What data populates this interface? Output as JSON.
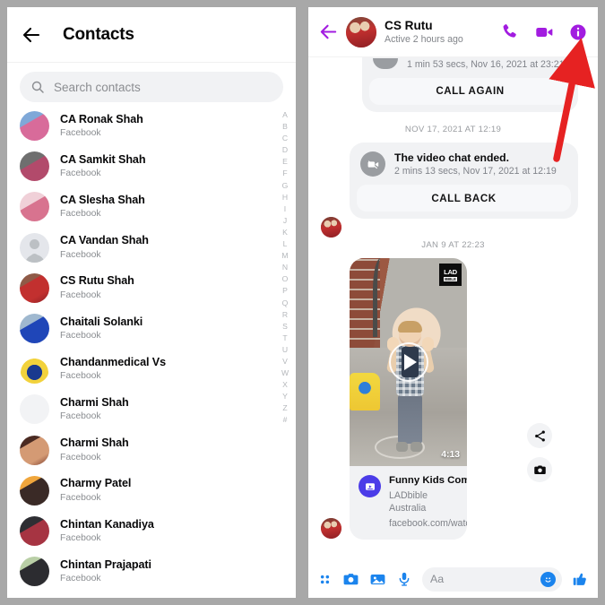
{
  "left_panel": {
    "header": {
      "title": "Contacts",
      "back_icon": "arrow-left-icon"
    },
    "search": {
      "placeholder": "Search contacts",
      "value": "",
      "icon": "search-icon"
    },
    "source_label": "Facebook",
    "contacts": [
      {
        "name": "CA Ronak Shah",
        "source": "Facebook",
        "avatar": "photo"
      },
      {
        "name": "CA Samkit Shah",
        "source": "Facebook",
        "avatar": "photo"
      },
      {
        "name": "CA Slesha Shah",
        "source": "Facebook",
        "avatar": "photo"
      },
      {
        "name": "CA Vandan Shah",
        "source": "Facebook",
        "avatar": "silhouette"
      },
      {
        "name": "CS Rutu Shah",
        "source": "Facebook",
        "avatar": "photo"
      },
      {
        "name": "Chaitali Solanki",
        "source": "Facebook",
        "avatar": "photo"
      },
      {
        "name": "Chandanmedical Vs",
        "source": "Facebook",
        "avatar": "photo"
      },
      {
        "name": "Charmi Shah",
        "source": "Facebook",
        "avatar": "blank"
      },
      {
        "name": "Charmi Shah",
        "source": "Facebook",
        "avatar": "photo"
      },
      {
        "name": "Charmy Patel",
        "source": "Facebook",
        "avatar": "photo"
      },
      {
        "name": "Chintan Kanadiya",
        "source": "Facebook",
        "avatar": "photo"
      },
      {
        "name": "Chintan Prajapati",
        "source": "Facebook",
        "avatar": "photo"
      }
    ],
    "alpha_index": [
      "A",
      "B",
      "C",
      "D",
      "E",
      "F",
      "G",
      "H",
      "I",
      "J",
      "K",
      "L",
      "M",
      "N",
      "O",
      "P",
      "Q",
      "R",
      "S",
      "T",
      "U",
      "V",
      "W",
      "X",
      "Y",
      "Z",
      "#"
    ]
  },
  "right_panel": {
    "header": {
      "back_icon": "arrow-left-icon",
      "title": "CS Rutu",
      "status": "Active 2 hours ago",
      "accent_color": "#a21ce0",
      "actions": [
        {
          "name": "audio-call-button",
          "icon": "phone-icon"
        },
        {
          "name": "video-call-button",
          "icon": "video-camera-icon"
        },
        {
          "name": "conversation-info-button",
          "icon": "info-circle-icon"
        }
      ]
    },
    "messages": [
      {
        "type": "call_log",
        "partial": true,
        "meta": "1 min 53 secs, Nov 16, 2021 at 23:21",
        "button": "CALL AGAIN"
      },
      {
        "type": "day_separator",
        "label": "NOV 17, 2021 AT 12:19"
      },
      {
        "type": "call_log",
        "icon": "video-camera-off-icon",
        "title": "The video chat ended.",
        "meta": "2 mins 13 secs, Nov 17, 2021 at 12:19",
        "button": "CALL BACK"
      },
      {
        "type": "day_separator",
        "label": "JAN 9 AT 22:23"
      },
      {
        "type": "video_attachment",
        "duration": "4:13",
        "watermark_line1": "LAD",
        "watermark_line2": "BIBLE",
        "play_icon": "play-circle-icon",
        "title": "Funny Kids Compilation",
        "publisher": "LADbible Australia",
        "url": "facebook.com/watch"
      }
    ],
    "side_actions": [
      {
        "name": "share-message-button",
        "icon": "share-icon"
      },
      {
        "name": "camera-reply-button",
        "icon": "camera-icon"
      }
    ],
    "composer": {
      "accent_color": "#1b84ed",
      "placeholder": "Aa",
      "value": "",
      "left_icons": [
        {
          "name": "more-apps-button",
          "icon": "grid-dots-icon"
        },
        {
          "name": "camera-button",
          "icon": "camera-icon"
        },
        {
          "name": "gallery-button",
          "icon": "image-icon"
        },
        {
          "name": "voice-message-button",
          "icon": "microphone-icon"
        }
      ],
      "emoji_icon": "smiley-icon",
      "like_icon": "thumbs-up-icon"
    }
  },
  "annotation": {
    "type": "arrow",
    "color": "#e62222",
    "points_at": "conversation-info-button"
  }
}
